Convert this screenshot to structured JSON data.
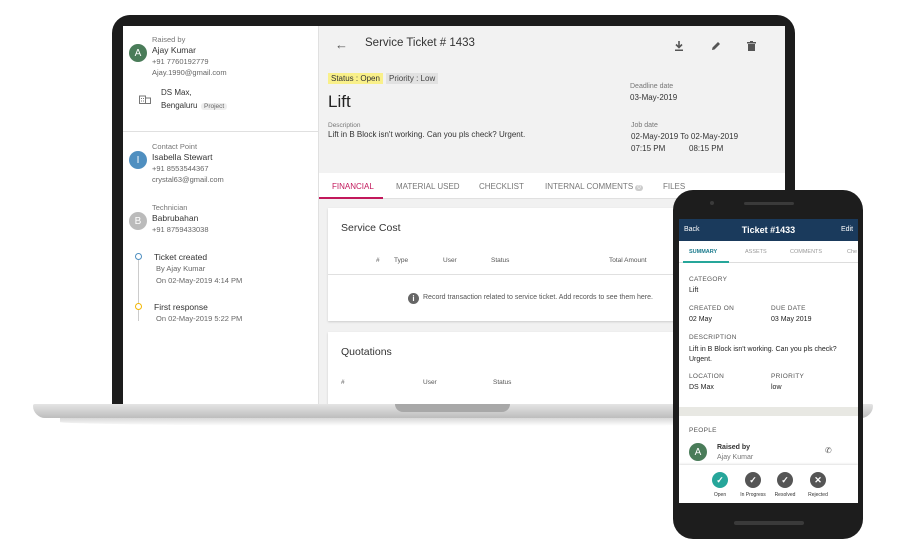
{
  "raised": {
    "label": "Raised by",
    "initial": "A",
    "name": "Ajay Kumar",
    "phone": "+91 7760192779",
    "email": "Ajay.1990@gmail.com",
    "site_line1": "DS Max,",
    "site_line2": "Bengaluru",
    "site_chip": "Project"
  },
  "contact": {
    "label": "Contact Point",
    "initial": "I",
    "name": "Isabella Stewart",
    "phone": "+91 8553544367",
    "email": "crystal63@gmail.com"
  },
  "tech": {
    "label": "Technician",
    "initial": "B",
    "name": "Babrubahan",
    "phone": "+91 8759433038"
  },
  "timeline": [
    {
      "title": "Ticket created",
      "by": "By Ajay Kumar",
      "on": "On 02-May-2019 4:14 PM"
    },
    {
      "title": "First response",
      "on": "On 02-May-2019 5:22 PM"
    }
  ],
  "header": {
    "title": "Service Ticket # 1433",
    "status": "Status : Open",
    "priority": "Priority : Low",
    "subject": "Lift",
    "desc_label": "Description",
    "desc": "Lift in B Block isn't working. Can you pls check? Urgent.",
    "deadline_label": "Deadline date",
    "deadline": "03-May-2019",
    "job_label": "Job date",
    "job_range": "02-May-2019 To 02-May-2019",
    "job_t1": "07:15 PM",
    "job_t2": "08:15 PM"
  },
  "tabs": [
    "FINANCIAL",
    "MATERIAL USED",
    "CHECKLIST",
    "INTERNAL COMMENTS",
    "FILES"
  ],
  "comments_count": "0",
  "service_cost": {
    "title": "Service Cost",
    "cols": [
      "#",
      "Type",
      "User",
      "Status",
      "Total Amount"
    ],
    "empty": "Record transaction related to service ticket. Add records to see them here."
  },
  "quotations": {
    "title": "Quotations",
    "cols": [
      "#",
      "User",
      "Status"
    ]
  },
  "phone": {
    "back": "Back",
    "title": "Ticket #1433",
    "edit": "Edit",
    "tabs": [
      "SUMMARY",
      "ASSETS",
      "COMMENTS",
      "Che"
    ],
    "category_label": "CATEGORY",
    "category": "Lift",
    "created_label": "CREATED ON",
    "created": "02 May",
    "due_label": "DUE DATE",
    "due": "03 May 2019",
    "desc_label": "DESCRIPTION",
    "desc": "Lift in B Block isn't working. Can you pls check? Urgent.",
    "loc_label": "LOCATION",
    "loc": "DS Max",
    "prio_label": "PRIORITY",
    "prio": "low",
    "people_label": "PEOPLE",
    "raised_label": "Raised by",
    "raised_name": "Ajay Kumar",
    "raised_initial": "A",
    "statuses": [
      "Open",
      "In Progress",
      "Resolved",
      "Rejected"
    ]
  },
  "colors": {
    "accent": "#c2185b",
    "status_bg": "#f9f08a",
    "phone_bar": "#1a3a5c",
    "open_green": "#26a69a"
  }
}
